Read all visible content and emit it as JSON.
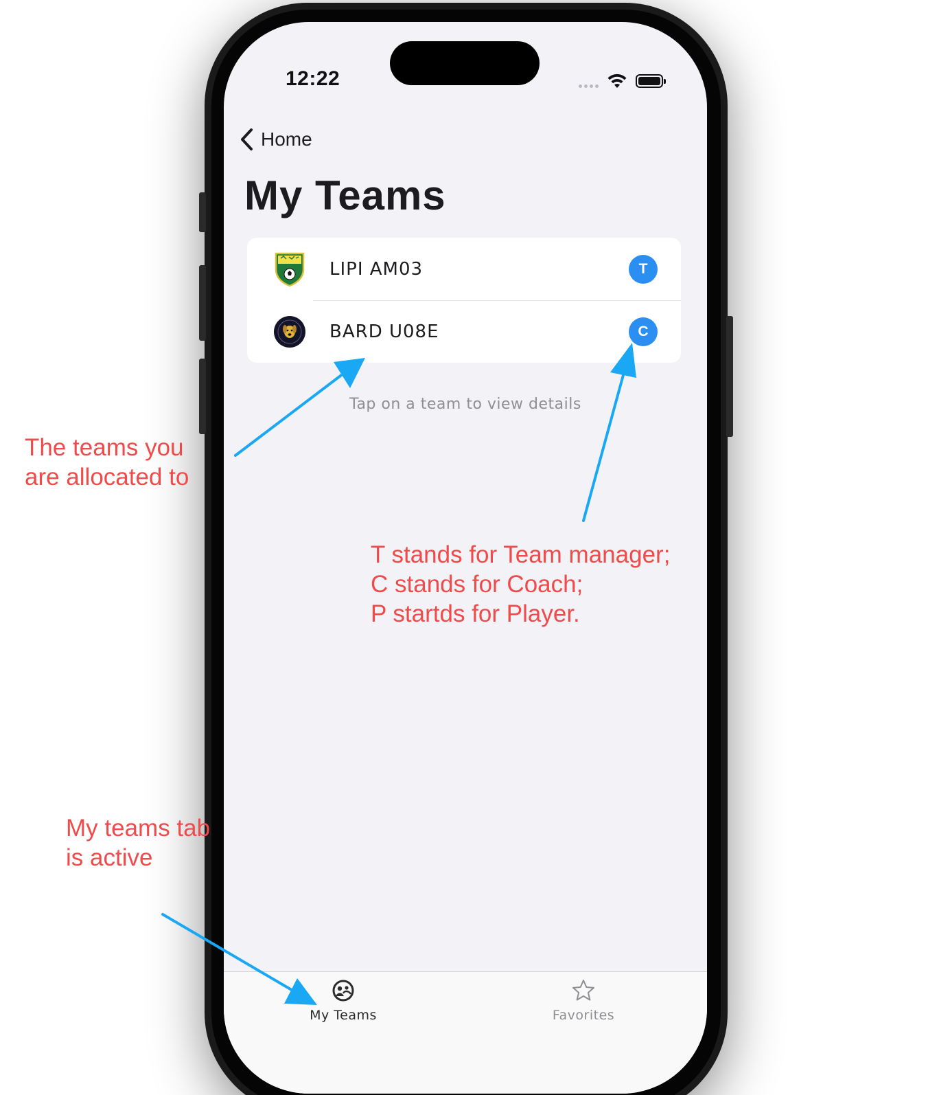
{
  "status_bar": {
    "time": "12:22"
  },
  "nav": {
    "back_label": "Home",
    "title": "My Teams"
  },
  "teams": [
    {
      "name": "LIPI AM03",
      "role": "T",
      "logo": "shield-crest-logo",
      "badge_color": "#2a8ff0"
    },
    {
      "name": "BARD U08E",
      "role": "C",
      "logo": "dog-round-logo",
      "badge_color": "#2a8ff0"
    }
  ],
  "hint": "Tap on a team to view details",
  "tabbar": {
    "tabs": [
      {
        "label": "My Teams",
        "icon": "teams-icon",
        "active": true,
        "color": "#2c2c2e"
      },
      {
        "label": "Favorites",
        "icon": "star-icon",
        "active": false,
        "color": "#8e8e93"
      }
    ]
  },
  "annotations": {
    "teams_note": "The teams you\nare allocated to",
    "roles_note": "T stands for Team manager;\nC stands for Coach;\nP startds for Player.",
    "tab_note": "My teams tab\nis active",
    "text_color": "#f04b4b",
    "arrow_color": "#1aa8f5"
  }
}
